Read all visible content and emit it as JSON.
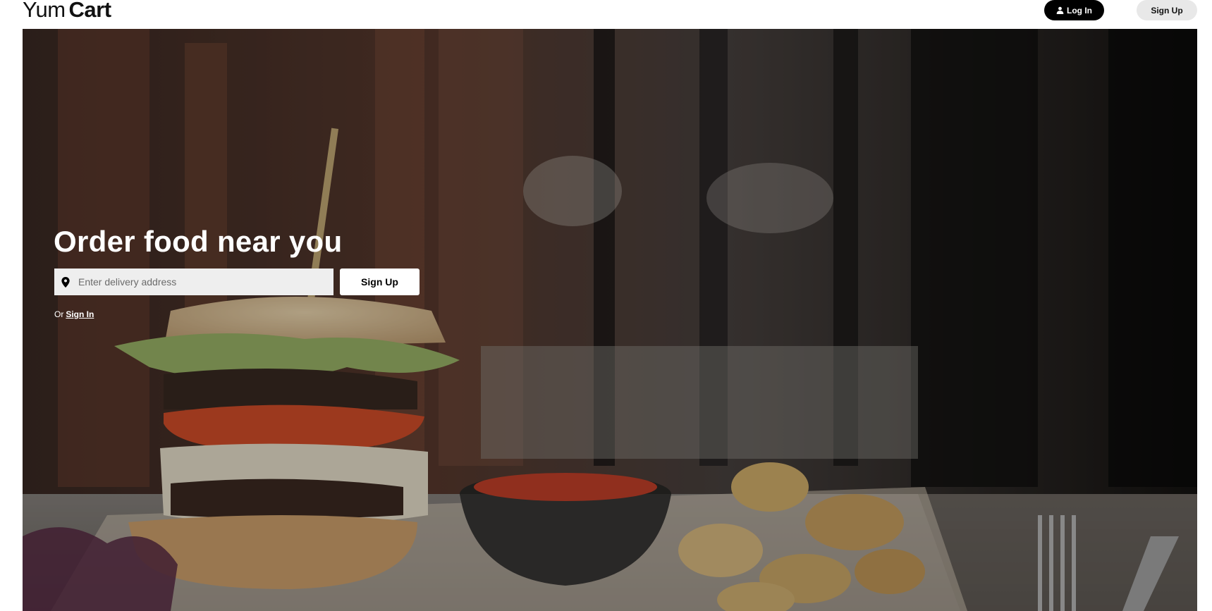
{
  "header": {
    "logo_light": "Yum",
    "logo_bold": "Cart",
    "login_label": "Log In",
    "login_icon": "user-icon",
    "signup_label": "Sign Up"
  },
  "hero": {
    "title": "Order food near you",
    "address_placeholder": "Enter delivery address",
    "address_value": "",
    "address_icon": "map-pin-icon",
    "signup_label": "Sign Up",
    "or_text": "Or",
    "signin_label": "Sign In"
  },
  "colors": {
    "primary": "#000000",
    "background": "#ffffff",
    "input_bg": "#eeeeee",
    "secondary_button_bg": "#e8e8e8"
  }
}
